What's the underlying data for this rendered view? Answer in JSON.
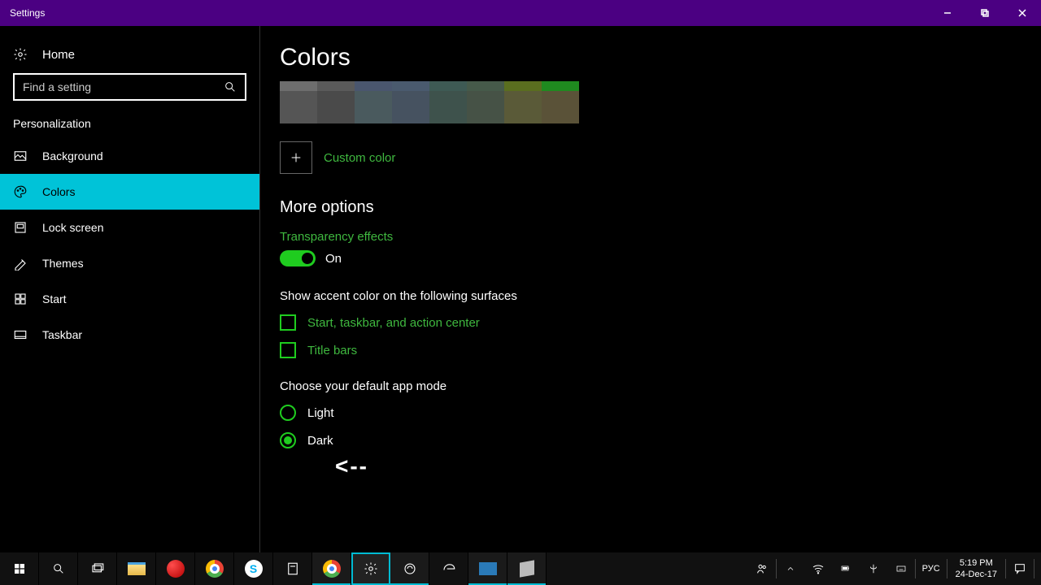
{
  "titlebar": {
    "title": "Settings"
  },
  "sidebar": {
    "home": "Home",
    "search_placeholder": "Find a setting",
    "section": "Personalization",
    "items": [
      {
        "label": "Background"
      },
      {
        "label": "Colors"
      },
      {
        "label": "Lock screen"
      },
      {
        "label": "Themes"
      },
      {
        "label": "Start"
      },
      {
        "label": "Taskbar"
      }
    ]
  },
  "content": {
    "title": "Colors",
    "swatches_row1": [
      "#6e6e6e",
      "#5a5a5a",
      "#4a566e",
      "#4a5a6e",
      "#3e5a54",
      "#465a4a",
      "#5a6e1f",
      "#1f8a1f"
    ],
    "swatches_row2": [
      "#555",
      "#4a4a4a",
      "#4a5a5e",
      "#465260",
      "#3e524c",
      "#465246",
      "#5a5a38",
      "#5a5238"
    ],
    "custom_color": "Custom color",
    "more_options": "More options",
    "transparency_label": "Transparency effects",
    "transparency_state": "On",
    "accent_heading": "Show accent color on the following surfaces",
    "accent_checks": [
      "Start, taskbar, and action center",
      "Title bars"
    ],
    "mode_heading": "Choose your default app mode",
    "mode_options": [
      "Light",
      "Dark"
    ],
    "annotation": "<--"
  },
  "taskbar": {
    "lang": "РУС",
    "time": "5:19 PM",
    "date": "24-Dec-17"
  }
}
